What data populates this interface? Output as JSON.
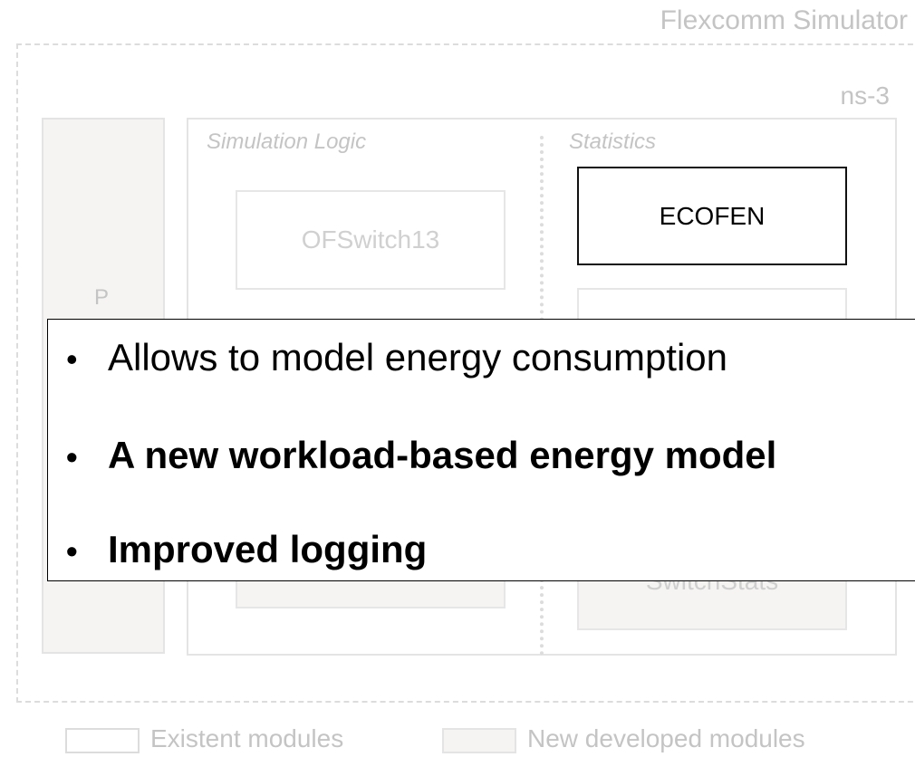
{
  "diagram": {
    "outer_title": "Flexcomm Simulator",
    "ns3_title": "ns-3",
    "p_label": "P",
    "simulation_logic_label": "Simulation Logic",
    "statistics_label": "Statistics",
    "modules": {
      "ofswitch13": "OFSwitch13",
      "ecofen": "ECOFEN",
      "switchstats": "SwitchStats"
    },
    "legend": {
      "existent": "Existent modules",
      "new_developed": "New developed modules"
    }
  },
  "overlay": {
    "bullets": [
      {
        "text": "Allows to model energy consumption",
        "bold": false
      },
      {
        "text": "A new workload-based energy model",
        "bold": true
      },
      {
        "text": "Improved logging",
        "bold": true
      }
    ],
    "bullet_symbol": "•"
  },
  "colors": {
    "faded_gray": "#c4c4c4",
    "new_module_fill": "#f5f4f2",
    "highlight_border": "#111111"
  }
}
